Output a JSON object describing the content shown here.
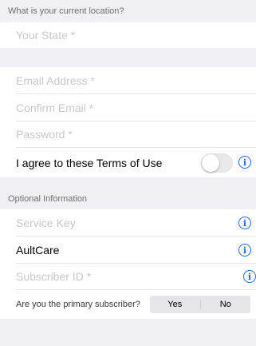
{
  "location_section": {
    "header": "What is your current location?",
    "state_placeholder": "Your State *"
  },
  "account_section": {
    "email_placeholder": "Email Address *",
    "confirm_email_placeholder": "Confirm Email *",
    "password_placeholder": "Password *",
    "terms_label": "I agree to these Terms of Use",
    "terms_toggle_on": false
  },
  "optional_section": {
    "header": "Optional Information",
    "service_key_placeholder": "Service Key",
    "plan_value": "AultCare",
    "subscriber_id_placeholder": "Subscriber ID *",
    "primary_question": "Are you the primary subscriber?",
    "options": [
      "Yes",
      "No"
    ]
  },
  "icons": {
    "info_glyph": "i",
    "accent_color": "#1f6fdc"
  }
}
